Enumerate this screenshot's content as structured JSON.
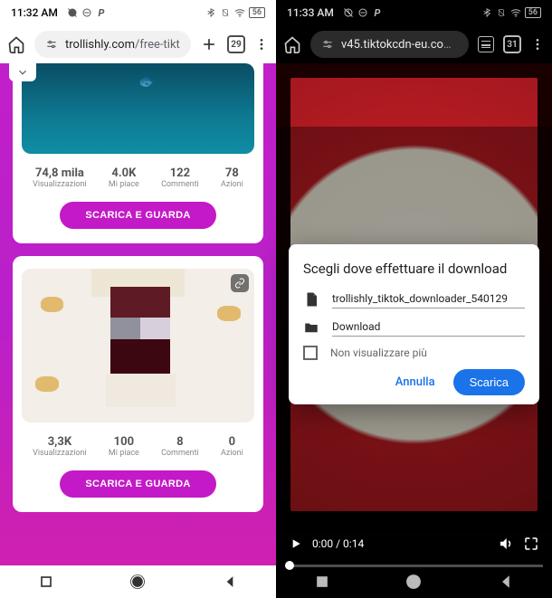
{
  "left": {
    "statusbar": {
      "time": "11:32 AM",
      "battery": "56"
    },
    "chrome": {
      "url_domain": "trollishly.com",
      "url_path": "/free-tikt",
      "tabs": "29"
    },
    "card1": {
      "stats": [
        {
          "num": "74,8 mila",
          "label": "Visualizzazioni"
        },
        {
          "num": "4.0K",
          "label": "Mi piace"
        },
        {
          "num": "122",
          "label": "Commenti"
        },
        {
          "num": "78",
          "label": "Azioni"
        }
      ],
      "button": "SCARICA E GUARDA"
    },
    "card2": {
      "stats": [
        {
          "num": "3,3K",
          "label": "Visualizzazioni"
        },
        {
          "num": "100",
          "label": "Mi piace"
        },
        {
          "num": "8",
          "label": "Commenti"
        },
        {
          "num": "0",
          "label": "Azioni"
        }
      ],
      "button": "SCARICA E GUARDA"
    }
  },
  "right": {
    "statusbar": {
      "time": "11:33 AM",
      "battery": "56"
    },
    "chrome": {
      "url_domain": "v45.tiktokcdn-eu.com",
      "url_path": "/",
      "tabs": "31"
    },
    "video": {
      "time": "0:00 / 0:14"
    },
    "dialog": {
      "title": "Scegli dove effettuare il download",
      "filename": "trollishly_tiktok_downloader_540129",
      "folder": "Download",
      "checkbox_label": "Non visualizzare più",
      "cancel": "Annulla",
      "confirm": "Scarica"
    }
  }
}
